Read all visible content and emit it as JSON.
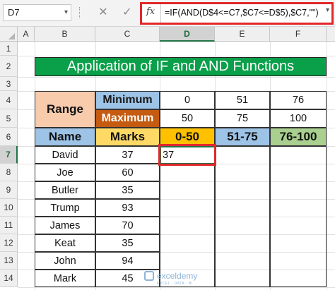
{
  "formula_bar": {
    "name_box": "D7",
    "cancel_glyph": "✕",
    "enter_glyph": "✓",
    "fx_glyph": "fx",
    "formula": "=IF(AND(D$4<=C7,$C7<=D$5),$C7,\"\")"
  },
  "columns": [
    "A",
    "B",
    "C",
    "D",
    "E",
    "F"
  ],
  "rows": [
    "1",
    "2",
    "3",
    "4",
    "5",
    "6",
    "7",
    "8",
    "9",
    "10",
    "11",
    "12",
    "13",
    "14"
  ],
  "sheet": {
    "title": "Application of IF and AND Functions",
    "range_label": "Range",
    "minimum_label": "Minimum",
    "maximum_label": "Maximum",
    "minimums": [
      "0",
      "51",
      "76"
    ],
    "maximums": [
      "50",
      "75",
      "100"
    ],
    "name_header": "Name",
    "marks_header": "Marks",
    "range_headers": [
      "0-50",
      "51-75",
      "76-100"
    ],
    "names": [
      "David",
      "Joe",
      "Butler",
      "Trump",
      "James",
      "Keat",
      "John",
      "Mark"
    ],
    "marks": [
      "37",
      "60",
      "35",
      "93",
      "70",
      "35",
      "94",
      "45"
    ],
    "d7_value": "37"
  },
  "colors": {
    "title_bg": "#0aa04a",
    "range_bg": "#f8cbad",
    "minimum_bg": "#9dc3e6",
    "maximum_bg": "#c55a11",
    "marks_bg": "#ffd966",
    "range1_bg": "#ffc000",
    "range3_bg": "#a9d08e",
    "highlight": "#e2272a",
    "selection": "#217346"
  },
  "watermark": {
    "name": "exceldemy",
    "tagline": "EXCEL · DATA · BI"
  }
}
